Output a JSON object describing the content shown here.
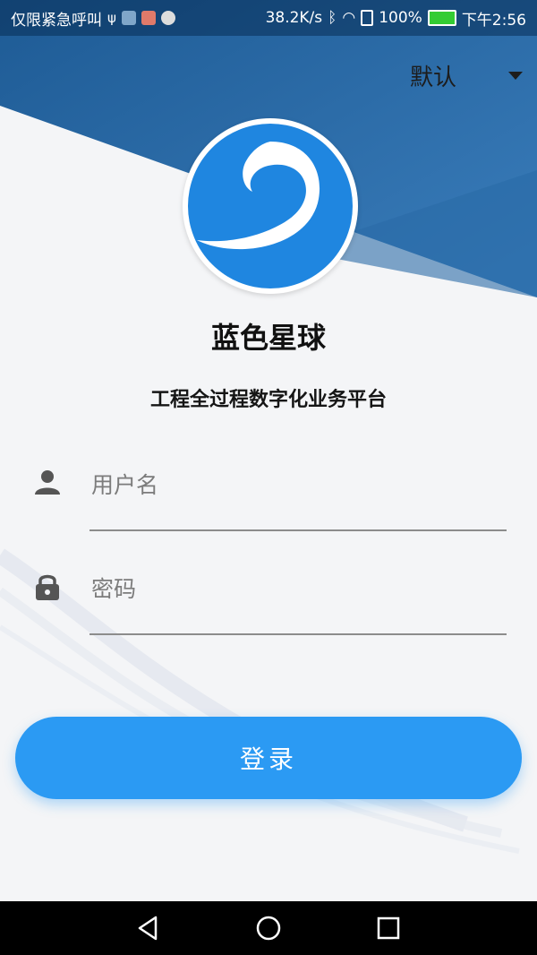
{
  "status_bar": {
    "carrier": "仅限紧急呼叫",
    "speed": "38.2K/s",
    "battery": "100%",
    "time": "下午2:56"
  },
  "env_select": {
    "selected": "默认"
  },
  "app": {
    "name": "蓝色星球",
    "subtitle": "工程全过程数字化业务平台"
  },
  "login_form": {
    "username_placeholder": "用户名",
    "username_value": "",
    "password_placeholder": "密码",
    "password_value": "",
    "submit_label": "登录"
  },
  "colors": {
    "header_blue": "#2e6faa",
    "accent": "#2b9af3",
    "logo_blue": "#1f86e0"
  },
  "icons": {
    "username": "person-icon",
    "password": "lock-icon",
    "nav": [
      "back-icon",
      "home-icon",
      "recents-icon"
    ]
  }
}
